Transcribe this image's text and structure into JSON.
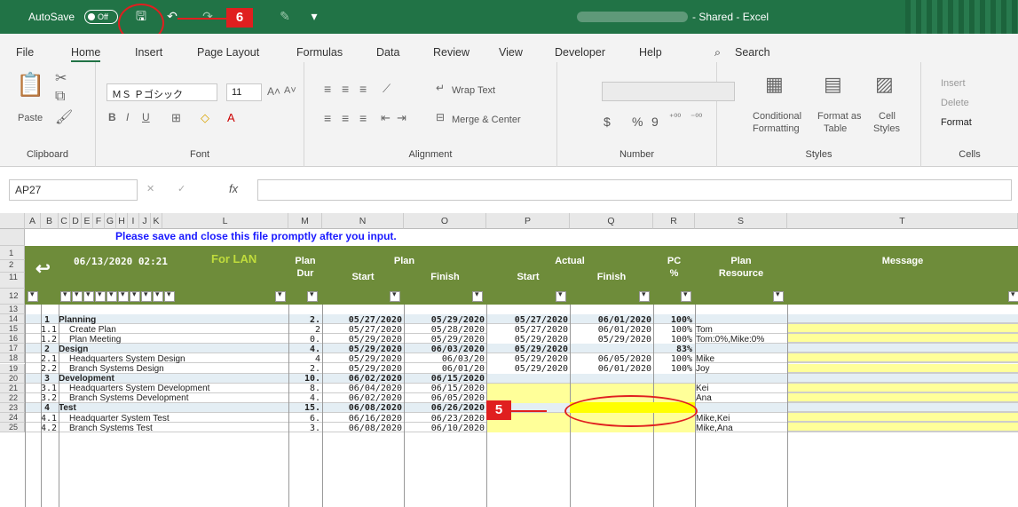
{
  "titlebar": {
    "autosave": "AutoSave",
    "toggle": "Off",
    "doc_title": "- Shared - Excel",
    "annotation6": "6"
  },
  "tabs": [
    "File",
    "Home",
    "Insert",
    "Page Layout",
    "Formulas",
    "Data",
    "Review",
    "View",
    "Developer",
    "Help",
    "Search"
  ],
  "ribbon": {
    "clipboard": {
      "paste": "Paste",
      "label": "Clipboard"
    },
    "font": {
      "name": "ＭＳ Ｐゴシック",
      "size": "11",
      "label": "Font"
    },
    "alignment": {
      "wrap": "Wrap Text",
      "merge": "Merge & Center",
      "label": "Alignment"
    },
    "number": {
      "currency": "$",
      "percent": "%",
      "comma": "9",
      "label": "Number"
    },
    "styles": {
      "cond": "Conditional",
      "cond2": "Formatting",
      "fmt": "Format as",
      "fmt2": "Table",
      "cell": "Cell",
      "cell2": "Styles",
      "label": "Styles"
    },
    "cells": {
      "insert": "Insert",
      "delete": "Delete",
      "format": "Format",
      "label": "Cells"
    }
  },
  "formula": {
    "namebox": "AP27",
    "fx": "fx"
  },
  "columns": [
    "A",
    "B",
    "C",
    "D",
    "E",
    "F",
    "G",
    "H",
    "I",
    "J",
    "K",
    "L",
    "M",
    "N",
    "O",
    "P",
    "Q",
    "R",
    "S",
    "T"
  ],
  "sheet": {
    "notice": "Please save and close this file promptly after you input.",
    "timestamp": "06/13/2020 02:21",
    "forlan": "For LAN",
    "h_plan_dur": "Plan",
    "h_plan_dur2": "Dur",
    "h_plan": "Plan",
    "h_start": "Start",
    "h_finish": "Finish",
    "h_actual": "Actual",
    "h_astart": "Start",
    "h_afinish": "Finish",
    "h_pc": "PC",
    "h_pc2": "%",
    "h_planres": "Plan",
    "h_planres2": "Resource",
    "h_message": "Message"
  },
  "rows": [
    {
      "rn": "14",
      "id": "1",
      "name": "Planning",
      "dur": "2.",
      "pstart": "05/27/2020",
      "pfinish": "05/29/2020",
      "astart": "05/27/2020",
      "afinish": "06/01/2020",
      "pc": "100%",
      "res": "",
      "bold": true
    },
    {
      "rn": "15",
      "id": "1.1",
      "name": "Create Plan",
      "dur": "2",
      "pstart": "05/27/2020",
      "pfinish": "05/28/2020",
      "astart": "05/27/2020",
      "afinish": "06/01/2020",
      "pc": "100%",
      "res": "Tom",
      "bold": false
    },
    {
      "rn": "16",
      "id": "1.2",
      "name": "Plan Meeting",
      "dur": "0.",
      "pstart": "05/29/2020",
      "pfinish": "05/29/2020",
      "astart": "05/29/2020",
      "afinish": "05/29/2020",
      "pc": "100%",
      "res": "Tom:0%,Mike:0%",
      "bold": false
    },
    {
      "rn": "17",
      "id": "2",
      "name": "Design",
      "dur": "4.",
      "pstart": "05/29/2020",
      "pfinish": "06/03/2020",
      "astart": "05/29/2020",
      "afinish": "",
      "pc": "83%",
      "res": "",
      "bold": true
    },
    {
      "rn": "18",
      "id": "2.1",
      "name": "Headquarters System Design",
      "dur": "4",
      "pstart": "05/29/2020",
      "pfinish": "06/03/20",
      "astart": "05/29/2020",
      "afinish": "06/05/2020",
      "pc": "100%",
      "res": "Mike",
      "bold": false
    },
    {
      "rn": "19",
      "id": "2.2",
      "name": "Branch Systems Design",
      "dur": "2.",
      "pstart": "05/29/2020",
      "pfinish": "06/01/20",
      "astart": "05/29/2020",
      "afinish": "06/01/2020",
      "pc": "100%",
      "res": "Joy",
      "bold": false
    },
    {
      "rn": "20",
      "id": "3",
      "name": "Development",
      "dur": "10.",
      "pstart": "06/02/2020",
      "pfinish": "06/15/2020",
      "astart": "",
      "afinish": "",
      "pc": "",
      "res": "",
      "bold": true
    },
    {
      "rn": "21",
      "id": "3.1",
      "name": "Headquarters System Development",
      "dur": "8.",
      "pstart": "06/04/2020",
      "pfinish": "06/15/2020",
      "astart": "",
      "afinish": "",
      "pc": "",
      "res": "Kei",
      "bold": false
    },
    {
      "rn": "22",
      "id": "3.2",
      "name": "Branch Systems Development",
      "dur": "4.",
      "pstart": "06/02/2020",
      "pfinish": "06/05/2020",
      "astart": "",
      "afinish": "",
      "pc": "",
      "res": "Ana",
      "bold": false
    },
    {
      "rn": "23",
      "id": "4",
      "name": "Test",
      "dur": "15.",
      "pstart": "06/08/2020",
      "pfinish": "06/26/2020",
      "astart": "",
      "afinish": "",
      "pc": "",
      "res": "",
      "bold": true
    },
    {
      "rn": "24",
      "id": "4.1",
      "name": "Headquarter System Test",
      "dur": "6.",
      "pstart": "06/16/2020",
      "pfinish": "06/23/2020",
      "astart": "",
      "afinish": "",
      "pc": "",
      "res": "Mike,Kei",
      "bold": false
    },
    {
      "rn": "25",
      "id": "4.2",
      "name": "Branch Systems Test",
      "dur": "3.",
      "pstart": "06/08/2020",
      "pfinish": "06/10/2020",
      "astart": "",
      "afinish": "",
      "pc": "",
      "res": "Mike,Ana",
      "bold": false
    }
  ],
  "annotation5": "5",
  "colors": {
    "excel_green": "#217346",
    "header_green": "#6e8c3a",
    "highlight_yellow": "#ffff99",
    "annotation_red": "#e01f1f",
    "notice_blue": "#1a1aff"
  }
}
